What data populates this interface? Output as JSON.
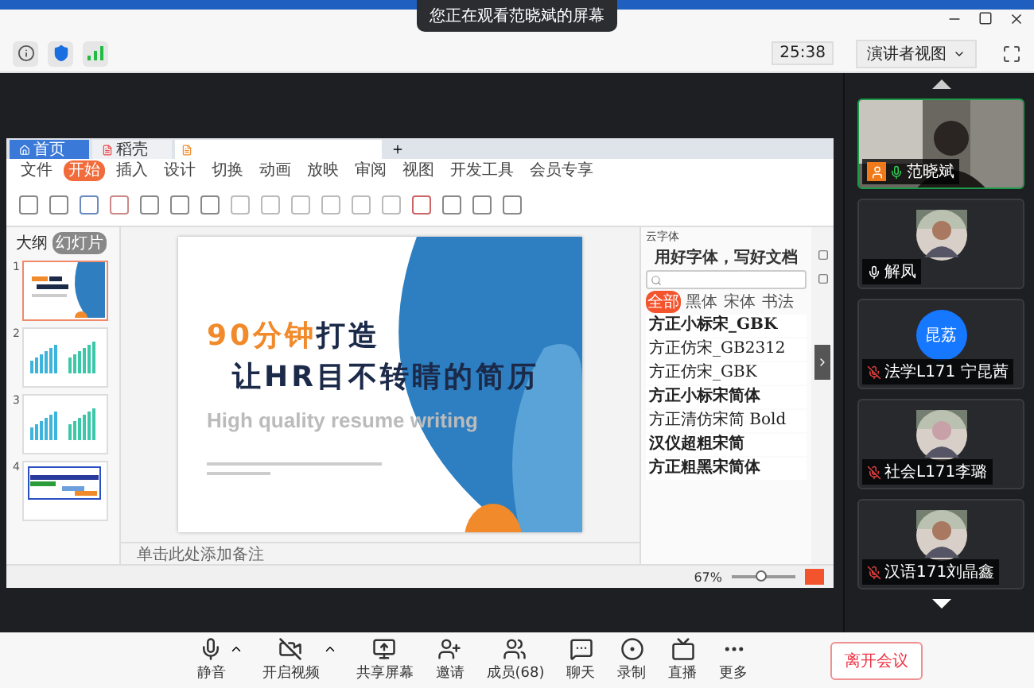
{
  "window": {
    "banner": "您正在观看范晓斌的屏幕",
    "timer": "25:38",
    "view_button": "演讲者视图"
  },
  "shared_screen": {
    "doc_tabs": [
      {
        "label": "首页",
        "kind": "home"
      },
      {
        "label": "稻壳",
        "kind": "docer"
      }
    ],
    "menu": [
      {
        "label": "文件",
        "selected": false
      },
      {
        "label": "开始",
        "selected": true
      },
      {
        "label": "插入",
        "selected": false
      },
      {
        "label": "设计",
        "selected": false
      },
      {
        "label": "切换",
        "selected": false
      },
      {
        "label": "动画",
        "selected": false
      },
      {
        "label": "放映",
        "selected": false
      },
      {
        "label": "审阅",
        "selected": false
      },
      {
        "label": "视图",
        "selected": false
      },
      {
        "label": "开发工具",
        "selected": false
      },
      {
        "label": "会员专享",
        "selected": false
      }
    ],
    "pane_tabs": [
      {
        "label": "大纲",
        "selected": false
      },
      {
        "label": "幻灯片",
        "selected": true
      }
    ],
    "slides": [
      {
        "number": "1",
        "kind": "title",
        "selected": true
      },
      {
        "number": "2",
        "kind": "chart",
        "selected": false
      },
      {
        "number": "3",
        "kind": "chart",
        "selected": false
      },
      {
        "number": "4",
        "kind": "table",
        "selected": false
      }
    ],
    "slide": {
      "title_highlight": "90分钟",
      "title_rest": "打造",
      "title_line2": "让HR目不转睛的简历",
      "english": "High quality resume writing"
    },
    "notes_placeholder": "单击此处添加备注",
    "zoom": "67%",
    "zoom_slider": {
      "level": 0.45
    },
    "font_panel": {
      "header": "云字体",
      "title": "用好字体，写好文档",
      "filters": [
        {
          "label": "全部",
          "selected": true
        },
        {
          "label": "黑体",
          "selected": false
        },
        {
          "label": "宋体",
          "selected": false
        },
        {
          "label": "书法",
          "selected": false
        }
      ],
      "fonts": [
        {
          "name": "方正小标宋_GBK",
          "bold": true
        },
        {
          "name": "方正仿宋_GB2312",
          "bold": false
        },
        {
          "name": "方正仿宋_GBK",
          "bold": false
        },
        {
          "name": "方正小标宋简体",
          "bold": true
        },
        {
          "name": "方正清仿宋简 Bold",
          "bold": false
        },
        {
          "name": "汉仪超粗宋简",
          "bold": true
        },
        {
          "name": "方正粗黑宋简体",
          "bold": true
        }
      ]
    }
  },
  "participants": [
    {
      "name": "范晓斌",
      "kind": "video",
      "muted": false,
      "speaking": true,
      "host": true,
      "selected": true
    },
    {
      "name": "解凤",
      "muted": false,
      "speaking": false,
      "host": false,
      "selected": false
    },
    {
      "name": "法学L171 宁昆茜",
      "kind": "initials",
      "initials": "昆荔",
      "muted": true,
      "host": false,
      "selected": false
    },
    {
      "name": "社会L171李璐",
      "muted": true,
      "host": false,
      "selected": false
    },
    {
      "name": "汉语171刘晶鑫",
      "muted": true,
      "host": false,
      "selected": false
    }
  ],
  "toolbar": [
    {
      "label": "静音",
      "kind": "mic",
      "menu_caret": true
    },
    {
      "label": "开启视频",
      "kind": "video",
      "menu_caret": true
    },
    {
      "label": "共享屏幕",
      "kind": "share",
      "menu_caret": false
    },
    {
      "label": "邀请",
      "kind": "invite",
      "menu_caret": false
    },
    {
      "label": "成员(68)",
      "kind": "members",
      "menu_caret": false
    },
    {
      "label": "聊天",
      "kind": "chat",
      "menu_caret": false
    },
    {
      "label": "录制",
      "kind": "record",
      "menu_caret": false
    },
    {
      "label": "直播",
      "kind": "live",
      "menu_caret": false
    },
    {
      "label": "更多",
      "kind": "more",
      "menu_caret": false
    }
  ],
  "leave_button": "离开会议"
}
